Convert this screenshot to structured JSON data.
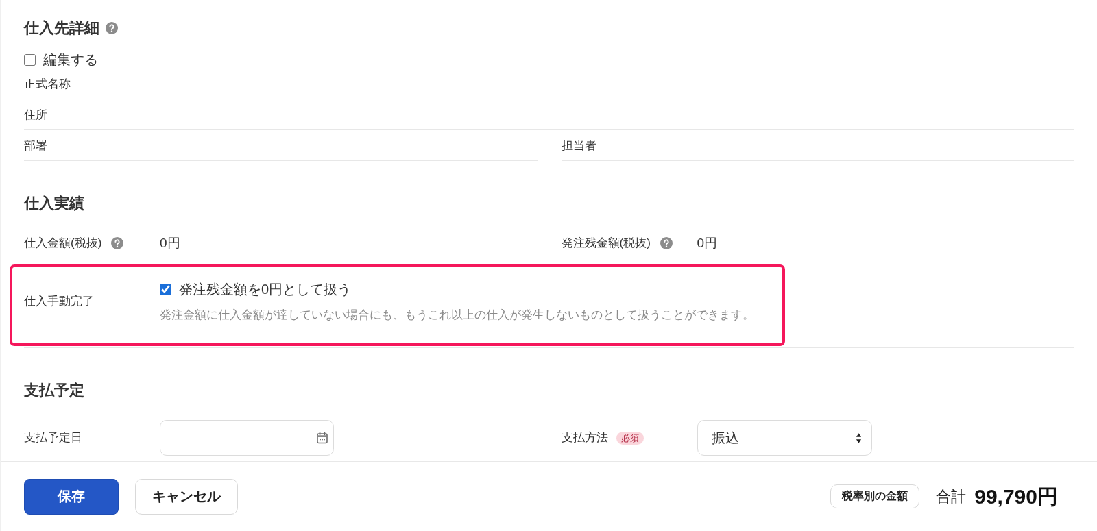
{
  "supplier_details": {
    "title": "仕入先詳細",
    "help": true,
    "edit_checkbox": {
      "label": "編集する",
      "checked": false
    },
    "fields": [
      {
        "label": "正式名称"
      },
      {
        "label": "住所"
      }
    ],
    "split_fields": [
      {
        "label": "部署"
      },
      {
        "label": "担当者"
      }
    ]
  },
  "purchase_results": {
    "title": "仕入実績",
    "amounts": [
      {
        "label": "仕入金額(税抜)",
        "help": true,
        "value": "0円"
      },
      {
        "label": "発注残金額(税抜)",
        "help": true,
        "value": "0円"
      }
    ],
    "manual_completion": {
      "label": "仕入手動完了",
      "highlighted": true,
      "checkbox": {
        "label": "発注残金額を0円として扱う",
        "checked": true
      },
      "description": "発注金額に仕入金額が達していない場合にも、もうこれ以上の仕入が発生しないものとして扱うことができます。"
    }
  },
  "payment_schedule": {
    "title": "支払予定",
    "fields": [
      {
        "kind": "date",
        "label": "支払予定日"
      },
      {
        "kind": "select",
        "label": "支払方法",
        "badge": "必須",
        "value": "振込"
      }
    ]
  },
  "footer": {
    "buttons": [
      {
        "kind": "primary",
        "label": "保存"
      },
      {
        "kind": "secondary",
        "label": "キャンセル"
      }
    ],
    "tax_button": "税率別の金額",
    "total_label": "合計",
    "total_value": "99,790円"
  }
}
